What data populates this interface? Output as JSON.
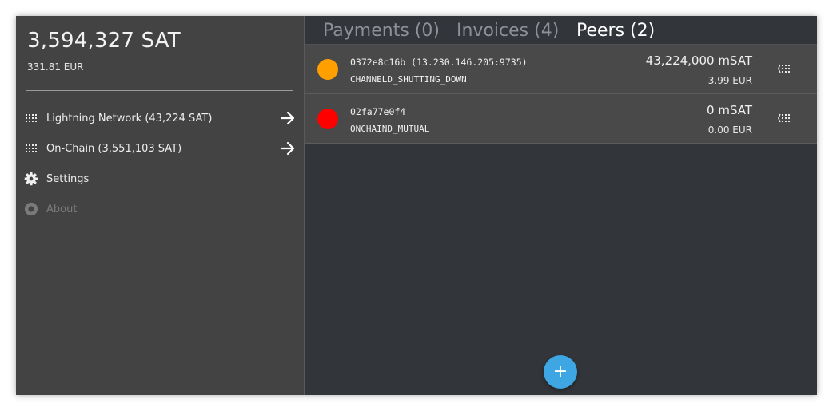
{
  "sidebar": {
    "balance": "3,594,327 SAT",
    "fiat": "331.81 EUR",
    "items": [
      {
        "label": "Lightning Network (43,224 SAT)",
        "icon": "lightning-grid-icon"
      },
      {
        "label": "On-Chain (3,551,103 SAT)",
        "icon": "onchain-grid-icon"
      },
      {
        "label": "Settings",
        "icon": "gear-icon"
      },
      {
        "label": "About",
        "icon": "info-circle-icon",
        "disabled": true
      }
    ]
  },
  "tabs": [
    {
      "label": "Payments (0)"
    },
    {
      "label": "Invoices (4)"
    },
    {
      "label": "Peers (2)",
      "active": true
    }
  ],
  "peers": [
    {
      "id": "0372e8c16b (13.230.146.205:9735)",
      "state": "CHANNELD_SHUTTING_DOWN",
      "amount": "43,224,000 mSAT",
      "fiat": "3.99 EUR",
      "status_color": "#ffa000"
    },
    {
      "id": "02fa77e0f4",
      "state": "ONCHAIND_MUTUAL",
      "amount": "0 mSAT",
      "fiat": "0.00 EUR",
      "status_color": "#ff0000"
    }
  ],
  "fab": {
    "label": "+"
  },
  "colors": {
    "accent": "#3ea6e2",
    "sidebar": "#434343",
    "main": "#32353a"
  }
}
